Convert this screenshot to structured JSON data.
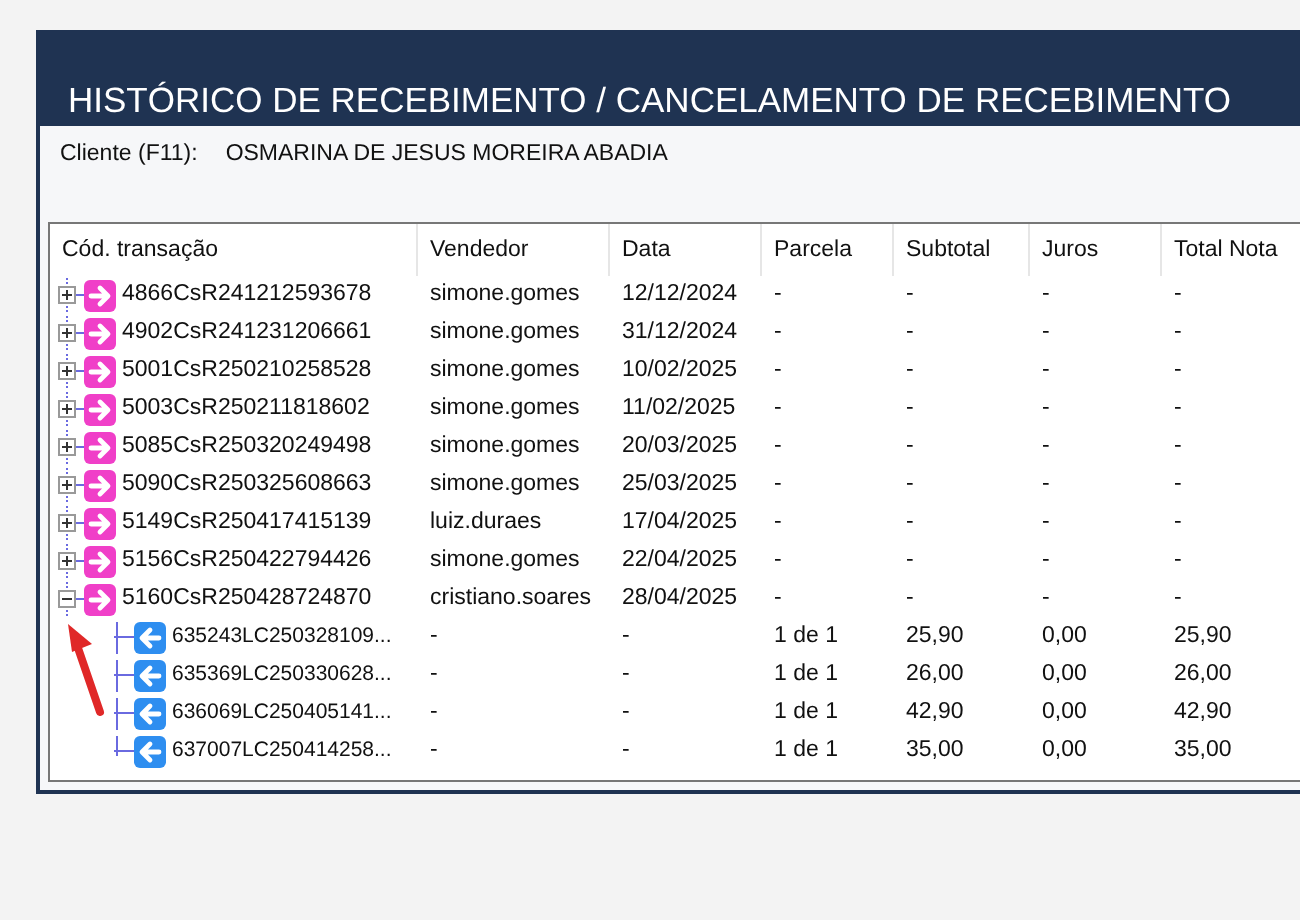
{
  "window": {
    "title": "HISTÓRICO DE RECEBIMENTO / CANCELAMENTO DE RECEBIMENTO"
  },
  "client": {
    "label": "Cliente (F11):",
    "value": "OSMARINA DE JESUS MOREIRA ABADIA"
  },
  "table": {
    "columns": [
      "Cód. transação",
      "Vendedor",
      "Data",
      "Parcela",
      "Subtotal",
      "Juros",
      "Total Nota"
    ],
    "rows": [
      {
        "kind": "receipt",
        "expanded": false,
        "cells": [
          "4866CsR241212593678",
          "simone.gomes",
          "12/12/2024",
          "-",
          "-",
          "-",
          "-"
        ]
      },
      {
        "kind": "receipt",
        "expanded": false,
        "cells": [
          "4902CsR241231206661",
          "simone.gomes",
          "31/12/2024",
          "-",
          "-",
          "-",
          "-"
        ]
      },
      {
        "kind": "receipt",
        "expanded": false,
        "cells": [
          "5001CsR250210258528",
          "simone.gomes",
          "10/02/2025",
          "-",
          "-",
          "-",
          "-"
        ]
      },
      {
        "kind": "receipt",
        "expanded": false,
        "cells": [
          "5003CsR250211818602",
          "simone.gomes",
          "11/02/2025",
          "-",
          "-",
          "-",
          "-"
        ]
      },
      {
        "kind": "receipt",
        "expanded": false,
        "cells": [
          "5085CsR250320249498",
          "simone.gomes",
          "20/03/2025",
          "-",
          "-",
          "-",
          "-"
        ]
      },
      {
        "kind": "receipt",
        "expanded": false,
        "cells": [
          "5090CsR250325608663",
          "simone.gomes",
          "25/03/2025",
          "-",
          "-",
          "-",
          "-"
        ]
      },
      {
        "kind": "receipt",
        "expanded": false,
        "cells": [
          "5149CsR250417415139",
          "luiz.duraes",
          "17/04/2025",
          "-",
          "-",
          "-",
          "-"
        ]
      },
      {
        "kind": "receipt",
        "expanded": false,
        "cells": [
          "5156CsR250422794426",
          "simone.gomes",
          "22/04/2025",
          "-",
          "-",
          "-",
          "-"
        ]
      },
      {
        "kind": "receipt",
        "expanded": true,
        "cells": [
          "5160CsR250428724870",
          "cristiano.soares",
          "28/04/2025",
          "-",
          "-",
          "-",
          "-"
        ],
        "children": [
          {
            "kind": "installment",
            "cells": [
              "635243LC250328109...",
              "-",
              "-",
              "1 de 1",
              "25,90",
              "0,00",
              "25,90"
            ]
          },
          {
            "kind": "installment",
            "cells": [
              "635369LC250330628...",
              "-",
              "-",
              "1 de 1",
              "26,00",
              "0,00",
              "26,00"
            ]
          },
          {
            "kind": "installment",
            "cells": [
              "636069LC250405141...",
              "-",
              "-",
              "1 de 1",
              "42,90",
              "0,00",
              "42,90"
            ]
          },
          {
            "kind": "installment",
            "cells": [
              "637007LC250414258...",
              "-",
              "-",
              "1 de 1",
              "35,00",
              "0,00",
              "35,00"
            ]
          }
        ]
      }
    ]
  },
  "annotation": {
    "kind": "arrow"
  }
}
